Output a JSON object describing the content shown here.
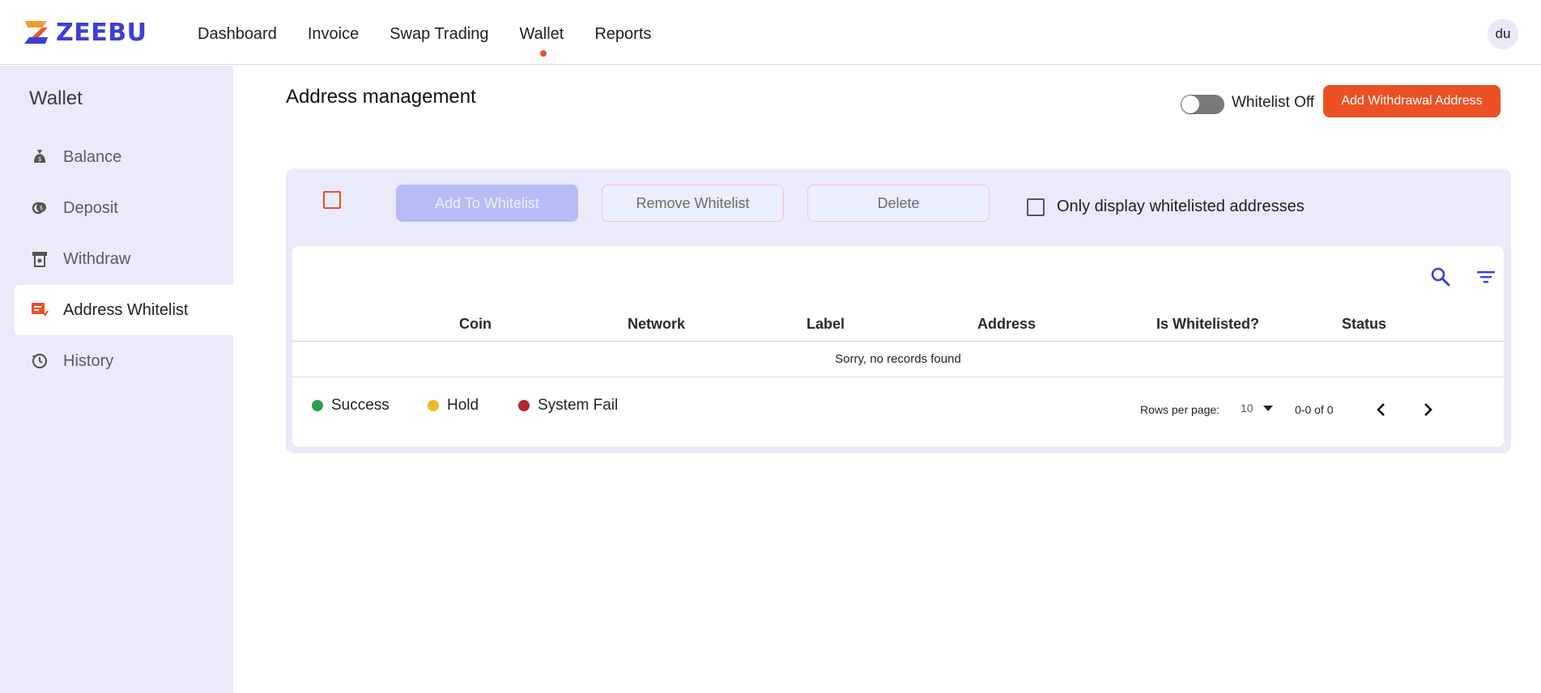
{
  "brand": {
    "name": "ZEEBU"
  },
  "nav": {
    "items": [
      {
        "label": "Dashboard"
      },
      {
        "label": "Invoice"
      },
      {
        "label": "Swap Trading"
      },
      {
        "label": "Wallet"
      },
      {
        "label": "Reports"
      }
    ],
    "active": "Wallet"
  },
  "user": {
    "initials": "du"
  },
  "sidebar": {
    "title": "Wallet",
    "items": [
      {
        "label": "Balance",
        "icon": "money-bag-icon"
      },
      {
        "label": "Deposit",
        "icon": "coins-icon"
      },
      {
        "label": "Withdraw",
        "icon": "atm-icon"
      },
      {
        "label": "Address Whitelist",
        "icon": "address-list-icon"
      },
      {
        "label": "History",
        "icon": "history-icon"
      }
    ],
    "active": "Address Whitelist"
  },
  "main": {
    "title": "Address management",
    "whitelist_toggle": {
      "label": "Whitelist Off",
      "on": false
    },
    "add_button": "Add Withdrawal Address",
    "actions": {
      "add_whitelist": "Add To Whitelist",
      "remove_whitelist": "Remove Whitelist",
      "delete": "Delete",
      "only_whitelisted": "Only display whitelisted addresses"
    },
    "table": {
      "columns": [
        "Coin",
        "Network",
        "Label",
        "Address",
        "Is Whitelisted?",
        "Status"
      ],
      "empty_message": "Sorry, no records found"
    },
    "legend": [
      {
        "label": "Success",
        "color": "#2e9e4f"
      },
      {
        "label": "Hold",
        "color": "#f0b92a"
      },
      {
        "label": "System Fail",
        "color": "#b3262b"
      }
    ],
    "pagination": {
      "rows_label": "Rows per page:",
      "rows_value": "10",
      "range": "0-0 of 0"
    }
  },
  "colors": {
    "accent": "#ec5126",
    "brand": "#3c3fd8",
    "sidebar_bg": "#e9ebfb"
  }
}
